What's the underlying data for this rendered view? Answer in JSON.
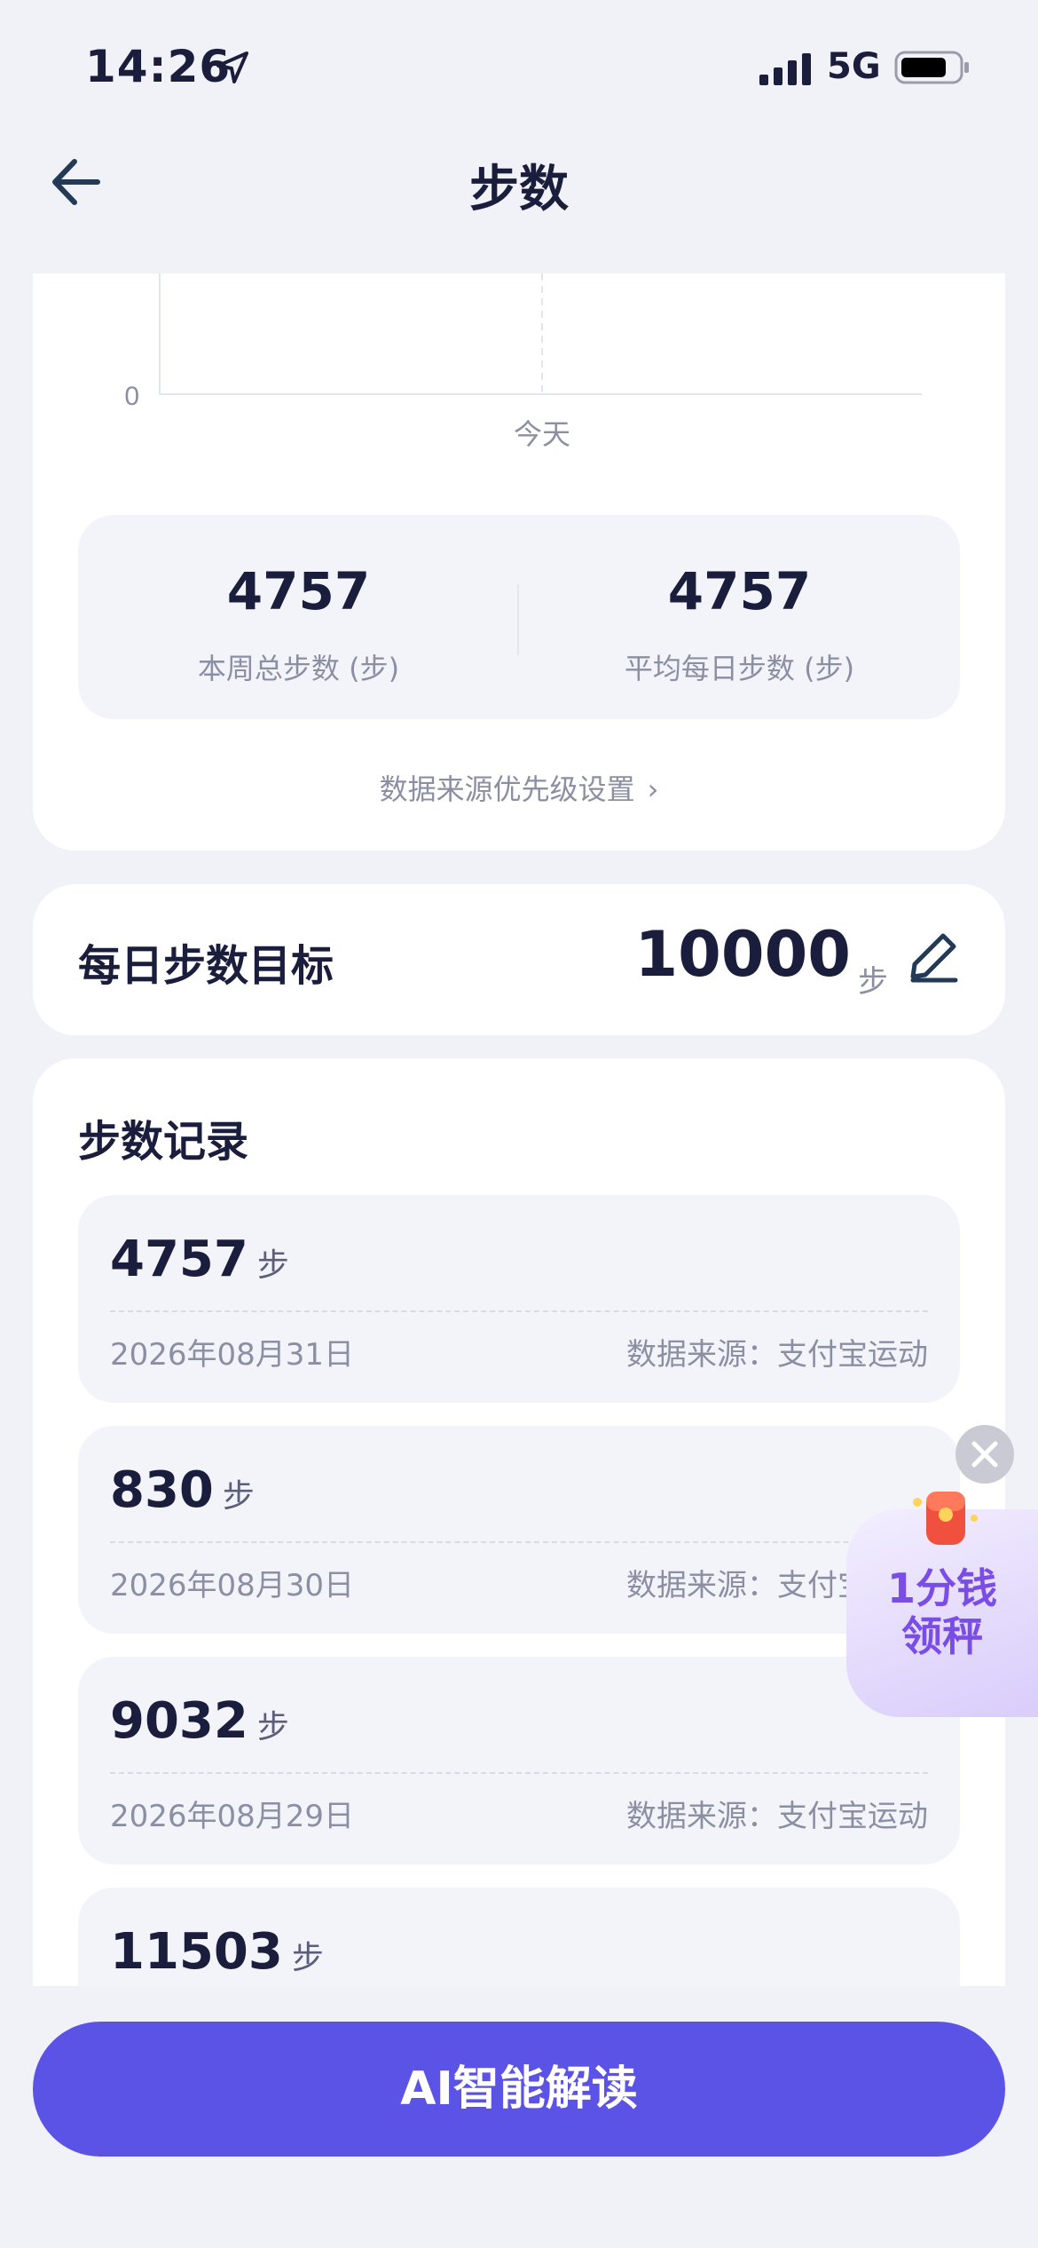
{
  "status": {
    "time": "14:26",
    "network": "5G"
  },
  "nav": {
    "title": "步数"
  },
  "chart": {
    "y_zero_label": "0",
    "x_label": "今天"
  },
  "stats": {
    "week_total": {
      "value": "4757",
      "label": "本周总步数 (步)"
    },
    "daily_avg": {
      "value": "4757",
      "label": "平均每日步数 (步)"
    }
  },
  "source_link": "数据来源优先级设置",
  "goal": {
    "label": "每日步数目标",
    "value": "10000",
    "unit": "步"
  },
  "records": {
    "title": "步数记录",
    "items": [
      {
        "value": "4757",
        "unit": "步",
        "date": "2026年08月31日",
        "source": "数据来源：支付宝运动"
      },
      {
        "value": "830",
        "unit": "步",
        "date": "2026年08月30日",
        "source": "数据来源：支付宝运动"
      },
      {
        "value": "9032",
        "unit": "步",
        "date": "2026年08月29日",
        "source": "数据来源：支付宝运动"
      },
      {
        "value": "11503",
        "unit": "步"
      }
    ]
  },
  "promo": {
    "line1": "1分钱",
    "line2": "领秤"
  },
  "ai_button": "AI智能解读",
  "colors": {
    "accent": "#5b52e6",
    "text": "#1b1d3d",
    "muted": "#8b8fa3",
    "bg": "#f1f2f7"
  }
}
